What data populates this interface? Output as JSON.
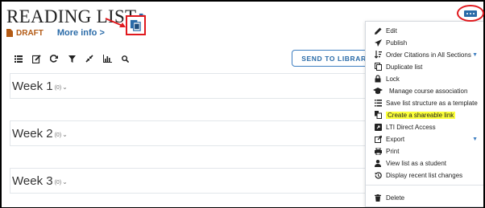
{
  "header": {
    "title": "READING LIST",
    "status": "DRAFT",
    "more_info": "More info",
    "more_info_chevron": ">"
  },
  "toolbar": {
    "send_label": "SEND TO LIBRARY",
    "icons": [
      "list-icon",
      "edit-icon",
      "refresh-icon",
      "filter-icon",
      "collapse-icon",
      "analytics-icon",
      "search-icon"
    ]
  },
  "weeks": [
    {
      "title": "Week 1",
      "count": "(0)"
    },
    {
      "title": "Week 2",
      "count": "(0)"
    },
    {
      "title": "Week 3",
      "count": "(0)"
    }
  ],
  "menu": {
    "items": [
      {
        "label": "Edit",
        "icon": "pencil-icon"
      },
      {
        "label": "Publish",
        "icon": "send-icon"
      },
      {
        "label": "Order Citations in All Sections",
        "icon": "sort-icon",
        "has_caret": true
      },
      {
        "label": "Duplicate list",
        "icon": "duplicate-icon"
      },
      {
        "label": "Lock",
        "icon": "lock-icon"
      },
      {
        "label": "Manage course association",
        "icon": "graduation-cap-icon"
      },
      {
        "label": "Save list structure as a template",
        "icon": "list-structure-icon"
      },
      {
        "label": "Create a shareable link",
        "icon": "share-link-icon",
        "highlighted": true
      },
      {
        "label": "LTI Direct Access",
        "icon": "external-square-icon"
      },
      {
        "label": "Export",
        "icon": "export-icon",
        "has_caret": true
      },
      {
        "label": "Print",
        "icon": "print-icon"
      },
      {
        "label": "View list as a student",
        "icon": "user-icon"
      },
      {
        "label": "Display recent list changes",
        "icon": "history-icon"
      },
      {
        "label": "Delete",
        "icon": "trash-icon"
      }
    ]
  },
  "colors": {
    "accent": "#2a6ba8",
    "draft": "#b35a14",
    "annotation_red": "#e0191e",
    "highlight": "#fbff3a"
  }
}
